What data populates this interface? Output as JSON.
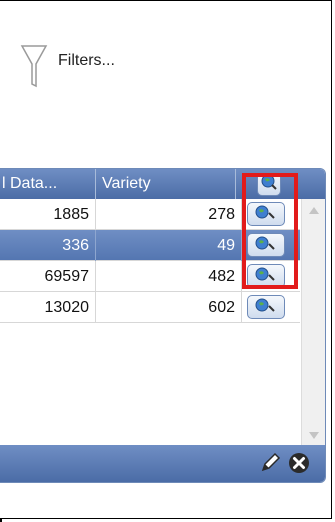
{
  "filters": {
    "label": "Filters..."
  },
  "grid": {
    "columns": [
      {
        "label": "l Data..."
      },
      {
        "label": "Variety"
      }
    ],
    "rows": [
      {
        "data": "1885",
        "variety": "278",
        "selected": false
      },
      {
        "data": "336",
        "variety": "49",
        "selected": true
      },
      {
        "data": "69597",
        "variety": "482",
        "selected": false
      },
      {
        "data": "13020",
        "variety": "602",
        "selected": false
      }
    ]
  },
  "icons": {
    "filter": "funnel-icon",
    "header_tool": "globe-search-icon",
    "row_tool": "globe-search-icon",
    "edit": "pencil-icon",
    "remove": "close-circle-icon"
  },
  "colors": {
    "header": "#5b7bb3",
    "selected_row": "#6384bd",
    "highlight": "#e21b1b"
  }
}
